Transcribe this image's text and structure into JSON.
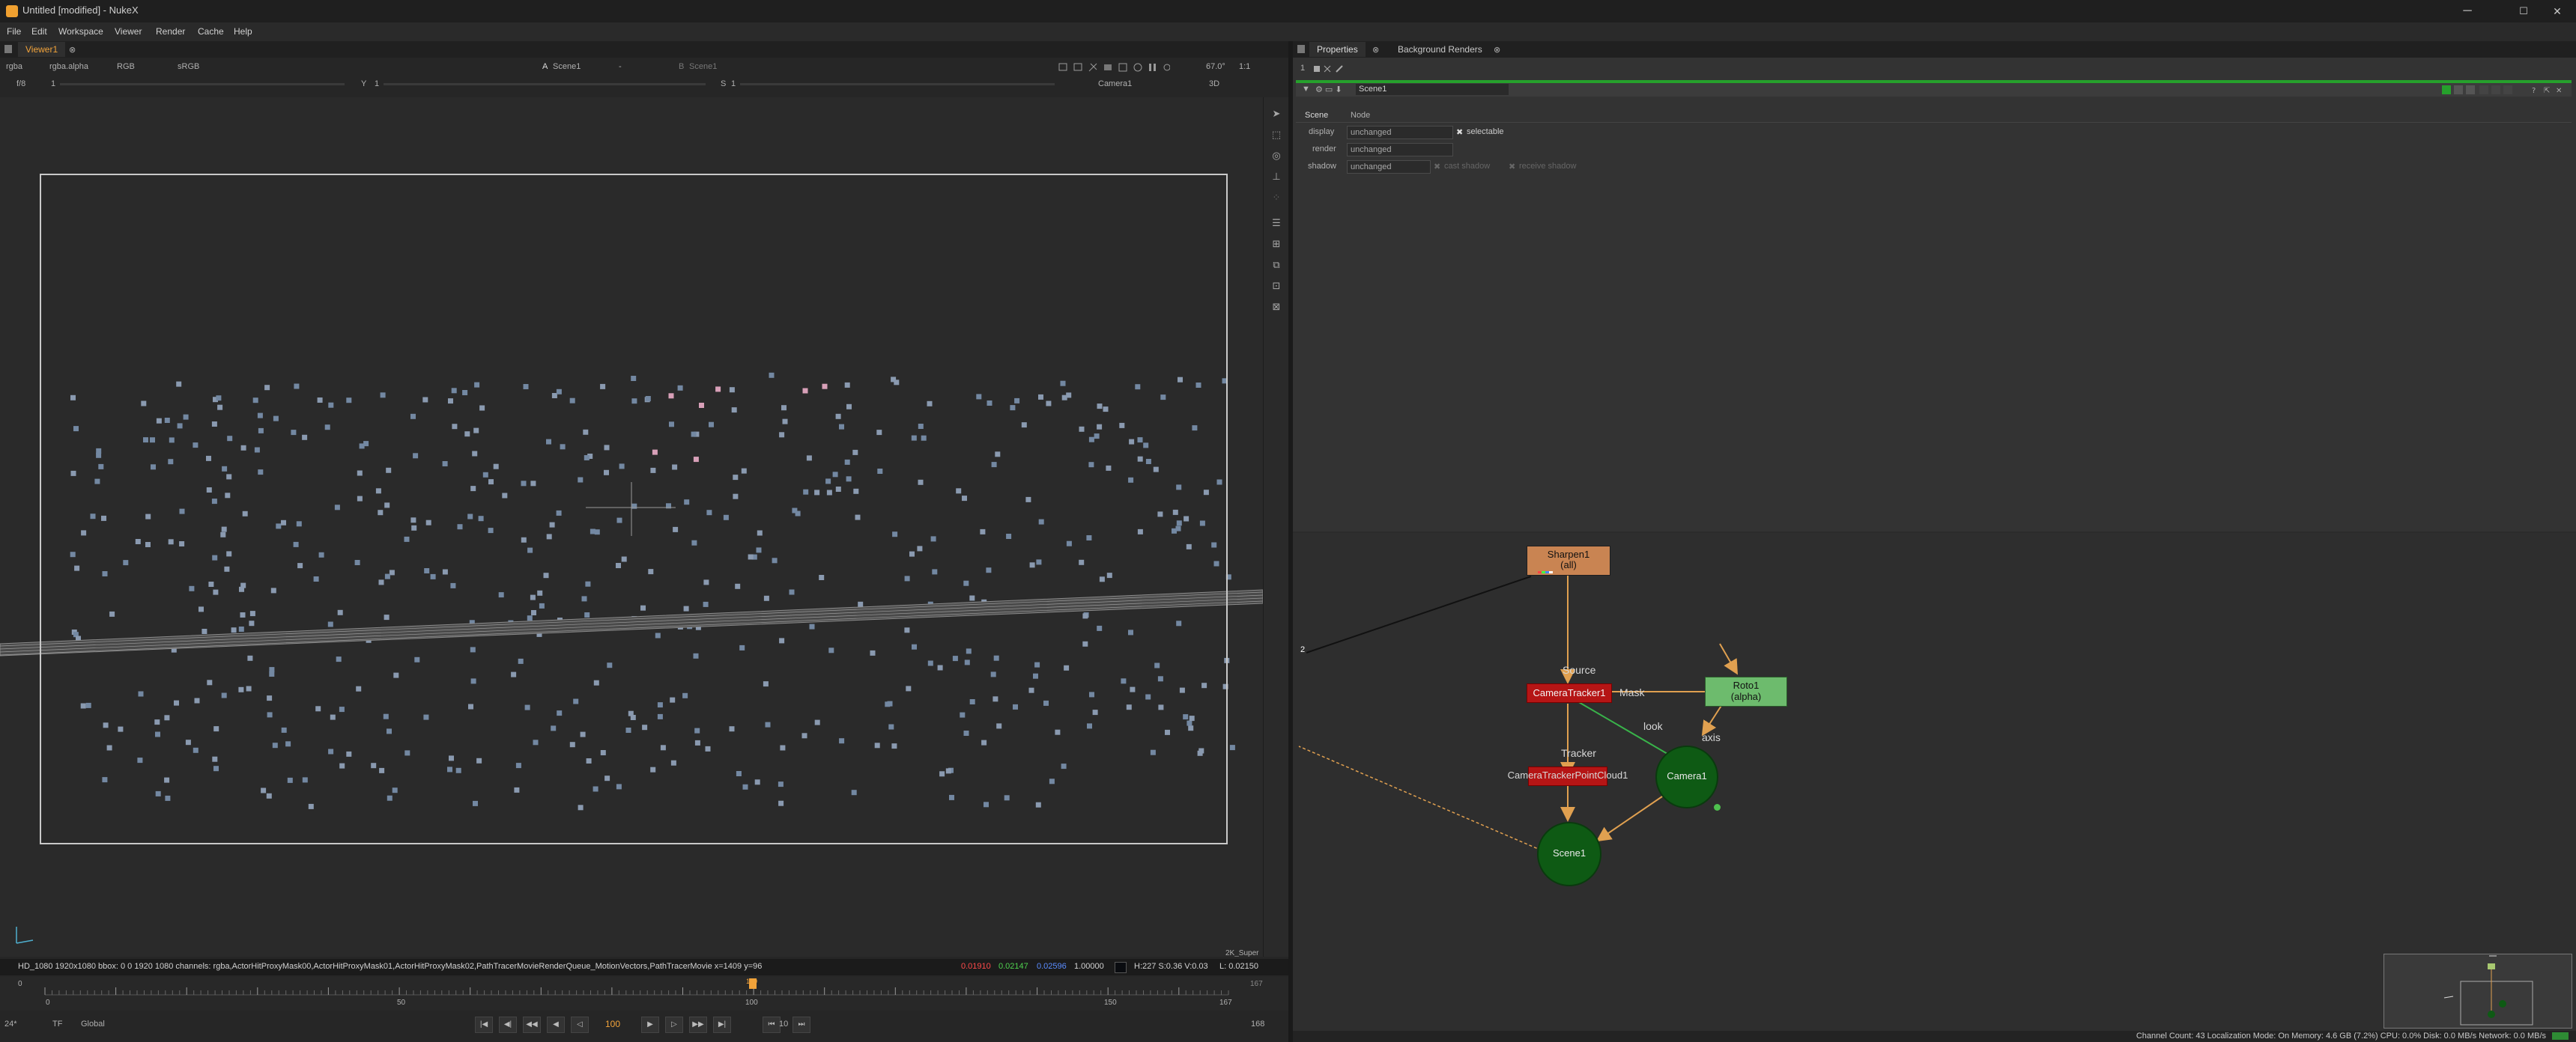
{
  "window": {
    "title": "Untitled [modified] - NukeX",
    "controls": {
      "minimize": "─",
      "maximize": "☐",
      "close": "✕"
    }
  },
  "menu": [
    "File",
    "Edit",
    "Workspace",
    "Viewer",
    "Render",
    "Cache",
    "Help"
  ],
  "viewer": {
    "tab_label": "Viewer1",
    "channels": "rgba",
    "alpha_channel": "rgba.alpha",
    "display": "RGB",
    "colorspace": "sRGB",
    "input_a_label": "A",
    "input_a": "Scene1",
    "operation": "-",
    "input_b_label": "B",
    "input_b": "Scene1",
    "zoom": "67.0°",
    "ratio": "1:1",
    "gain_label": "f/8",
    "gain_value": "1",
    "y_label": "Y",
    "y_value": "1",
    "s_label": "S",
    "s_value": "1",
    "camera": "Camera1",
    "mode": "3D",
    "format_label": "2K_Super",
    "info_bar": "HD_1080 1920x1080  bbox: 0 0 1920 1080  channels: rgba,ActorHitProxyMask00,ActorHitProxyMask01,ActorHitProxyMask02,PathTracerMovieRenderQueue_MotionVectors,PathTracerMovie  x=1409 y=96",
    "pixel_r": "0.01910",
    "pixel_g": "0.02147",
    "pixel_b": "0.02596",
    "pixel_a": "1.00000",
    "hsv": "H:227 S:0.36 V:0.03",
    "lum": "L: 0.02150"
  },
  "timeline": {
    "ticks": [
      "0",
      "50",
      "100",
      "150"
    ],
    "start": "0",
    "end": "167",
    "current": "100",
    "in_point": "1",
    "out_point": "167"
  },
  "playback": {
    "fps": "24*",
    "tf": "TF",
    "scope": "Global",
    "frame": "100",
    "increment": "10",
    "end_frame": "168"
  },
  "properties": {
    "tabs": [
      "Properties",
      "Background Renders"
    ],
    "count": "1",
    "node_name": "Scene1",
    "subtabs": [
      "Scene",
      "Node"
    ],
    "rows": [
      {
        "label": "display",
        "value": "unchanged",
        "check_label": "selectable",
        "checked": true
      },
      {
        "label": "render",
        "value": "unchanged"
      },
      {
        "label": "shadow",
        "value": "unchanged",
        "extra_checks": [
          "cast shadow",
          "receive shadow"
        ]
      }
    ]
  },
  "nodegraph": {
    "nodes": {
      "sharpen": {
        "name": "Sharpen1",
        "sub": "(all)",
        "color": "#c98452"
      },
      "tracker": {
        "name": "CameraTracker1",
        "color": "#b51515"
      },
      "roto": {
        "name": "Roto1",
        "sub": "(alpha)",
        "color": "#6dbb6d"
      },
      "pointcloud": {
        "name": "CameraTrackerPointCloud1",
        "color": "#b51515"
      },
      "camera": {
        "name": "Camera1",
        "color": "#0e5a14"
      },
      "scene": {
        "name": "Scene1",
        "color": "#0e5a14"
      }
    },
    "edge_labels": {
      "source": "Source",
      "mask": "Mask",
      "look": "look",
      "tracker": "Tracker",
      "axis": "axis"
    },
    "dot_label": "2"
  },
  "statusbar": "Channel Count: 43  Localization Mode: On  Memory: 4.6 GB (7.2%)  CPU: 0.0%  Disk: 0.0 MB/s  Network: 0.0 MB/s",
  "colors": {
    "accent": "#f2a33a",
    "edge": "#e0a050",
    "selection": "#26a02c"
  }
}
